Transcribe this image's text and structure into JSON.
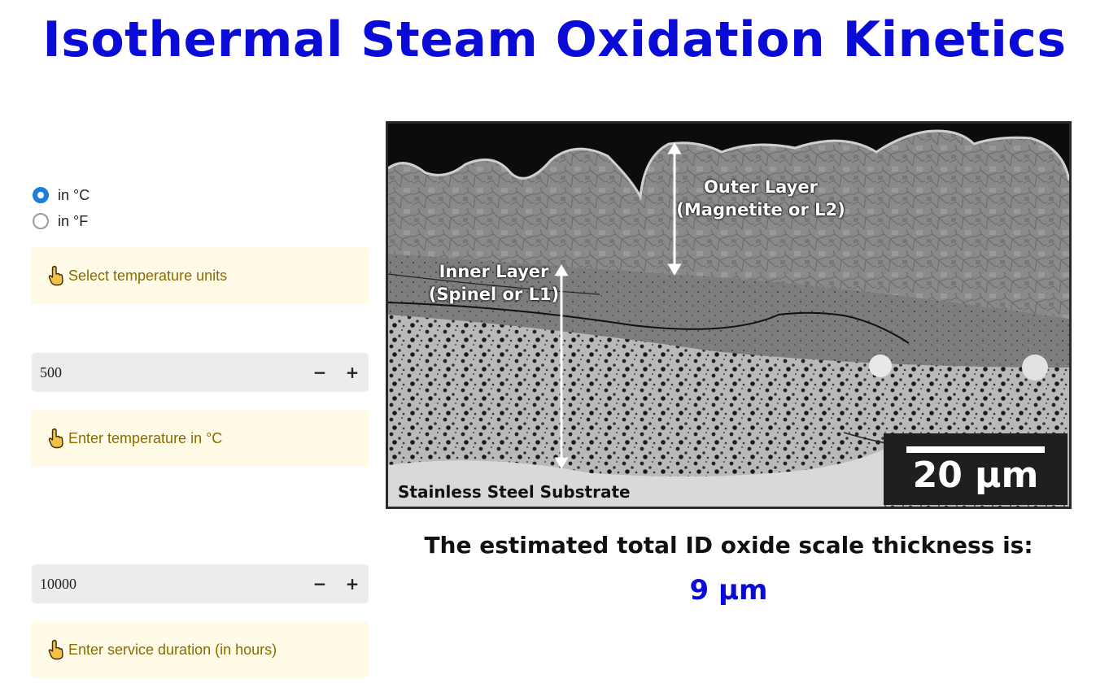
{
  "page": {
    "title": "Isothermal Steam Oxidation Kinetics",
    "title_color": "#0b0bd8",
    "accent_color": "#1c7ed6"
  },
  "units": {
    "options": [
      {
        "label": "in °C",
        "selected": true
      },
      {
        "label": "in °F",
        "selected": false
      }
    ],
    "hint": "Select temperature units",
    "hint_icon": "pointing-hand-icon"
  },
  "temperature": {
    "value": "500",
    "decrement_label": "−",
    "increment_label": "+",
    "hint": "Enter temperature in °C"
  },
  "duration": {
    "value": "10000",
    "decrement_label": "−",
    "increment_label": "+",
    "hint": "Enter service duration (in hours)"
  },
  "micrograph": {
    "outer_layer_label_line1": "Outer Layer",
    "outer_layer_label_line2": "(Magnetite or L2)",
    "inner_layer_label_line1": "Inner Layer",
    "inner_layer_label_line2": "(Spinel or L1)",
    "substrate_label": "Stainless Steel Substrate",
    "scale_bar_label": "20 μm"
  },
  "result": {
    "label": "The estimated total ID oxide scale thickness is:",
    "value": "9 μm"
  }
}
